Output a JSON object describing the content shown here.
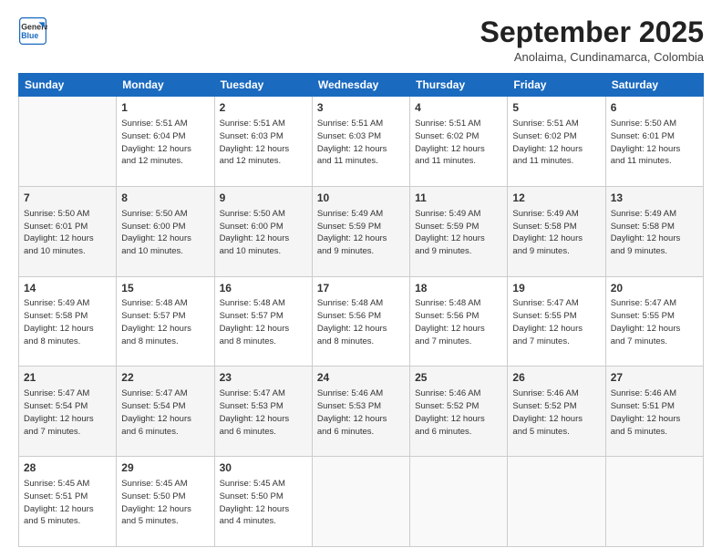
{
  "logo": {
    "line1": "General",
    "line2": "Blue"
  },
  "header": {
    "month": "September 2025",
    "location": "Anolaima, Cundinamarca, Colombia"
  },
  "weekdays": [
    "Sunday",
    "Monday",
    "Tuesday",
    "Wednesday",
    "Thursday",
    "Friday",
    "Saturday"
  ],
  "weeks": [
    [
      {
        "day": "",
        "info": ""
      },
      {
        "day": "1",
        "info": "Sunrise: 5:51 AM\nSunset: 6:04 PM\nDaylight: 12 hours\nand 12 minutes."
      },
      {
        "day": "2",
        "info": "Sunrise: 5:51 AM\nSunset: 6:03 PM\nDaylight: 12 hours\nand 12 minutes."
      },
      {
        "day": "3",
        "info": "Sunrise: 5:51 AM\nSunset: 6:03 PM\nDaylight: 12 hours\nand 11 minutes."
      },
      {
        "day": "4",
        "info": "Sunrise: 5:51 AM\nSunset: 6:02 PM\nDaylight: 12 hours\nand 11 minutes."
      },
      {
        "day": "5",
        "info": "Sunrise: 5:51 AM\nSunset: 6:02 PM\nDaylight: 12 hours\nand 11 minutes."
      },
      {
        "day": "6",
        "info": "Sunrise: 5:50 AM\nSunset: 6:01 PM\nDaylight: 12 hours\nand 11 minutes."
      }
    ],
    [
      {
        "day": "7",
        "info": "Sunrise: 5:50 AM\nSunset: 6:01 PM\nDaylight: 12 hours\nand 10 minutes."
      },
      {
        "day": "8",
        "info": "Sunrise: 5:50 AM\nSunset: 6:00 PM\nDaylight: 12 hours\nand 10 minutes."
      },
      {
        "day": "9",
        "info": "Sunrise: 5:50 AM\nSunset: 6:00 PM\nDaylight: 12 hours\nand 10 minutes."
      },
      {
        "day": "10",
        "info": "Sunrise: 5:49 AM\nSunset: 5:59 PM\nDaylight: 12 hours\nand 9 minutes."
      },
      {
        "day": "11",
        "info": "Sunrise: 5:49 AM\nSunset: 5:59 PM\nDaylight: 12 hours\nand 9 minutes."
      },
      {
        "day": "12",
        "info": "Sunrise: 5:49 AM\nSunset: 5:58 PM\nDaylight: 12 hours\nand 9 minutes."
      },
      {
        "day": "13",
        "info": "Sunrise: 5:49 AM\nSunset: 5:58 PM\nDaylight: 12 hours\nand 9 minutes."
      }
    ],
    [
      {
        "day": "14",
        "info": "Sunrise: 5:49 AM\nSunset: 5:58 PM\nDaylight: 12 hours\nand 8 minutes."
      },
      {
        "day": "15",
        "info": "Sunrise: 5:48 AM\nSunset: 5:57 PM\nDaylight: 12 hours\nand 8 minutes."
      },
      {
        "day": "16",
        "info": "Sunrise: 5:48 AM\nSunset: 5:57 PM\nDaylight: 12 hours\nand 8 minutes."
      },
      {
        "day": "17",
        "info": "Sunrise: 5:48 AM\nSunset: 5:56 PM\nDaylight: 12 hours\nand 8 minutes."
      },
      {
        "day": "18",
        "info": "Sunrise: 5:48 AM\nSunset: 5:56 PM\nDaylight: 12 hours\nand 7 minutes."
      },
      {
        "day": "19",
        "info": "Sunrise: 5:47 AM\nSunset: 5:55 PM\nDaylight: 12 hours\nand 7 minutes."
      },
      {
        "day": "20",
        "info": "Sunrise: 5:47 AM\nSunset: 5:55 PM\nDaylight: 12 hours\nand 7 minutes."
      }
    ],
    [
      {
        "day": "21",
        "info": "Sunrise: 5:47 AM\nSunset: 5:54 PM\nDaylight: 12 hours\nand 7 minutes."
      },
      {
        "day": "22",
        "info": "Sunrise: 5:47 AM\nSunset: 5:54 PM\nDaylight: 12 hours\nand 6 minutes."
      },
      {
        "day": "23",
        "info": "Sunrise: 5:47 AM\nSunset: 5:53 PM\nDaylight: 12 hours\nand 6 minutes."
      },
      {
        "day": "24",
        "info": "Sunrise: 5:46 AM\nSunset: 5:53 PM\nDaylight: 12 hours\nand 6 minutes."
      },
      {
        "day": "25",
        "info": "Sunrise: 5:46 AM\nSunset: 5:52 PM\nDaylight: 12 hours\nand 6 minutes."
      },
      {
        "day": "26",
        "info": "Sunrise: 5:46 AM\nSunset: 5:52 PM\nDaylight: 12 hours\nand 5 minutes."
      },
      {
        "day": "27",
        "info": "Sunrise: 5:46 AM\nSunset: 5:51 PM\nDaylight: 12 hours\nand 5 minutes."
      }
    ],
    [
      {
        "day": "28",
        "info": "Sunrise: 5:45 AM\nSunset: 5:51 PM\nDaylight: 12 hours\nand 5 minutes."
      },
      {
        "day": "29",
        "info": "Sunrise: 5:45 AM\nSunset: 5:50 PM\nDaylight: 12 hours\nand 5 minutes."
      },
      {
        "day": "30",
        "info": "Sunrise: 5:45 AM\nSunset: 5:50 PM\nDaylight: 12 hours\nand 4 minutes."
      },
      {
        "day": "",
        "info": ""
      },
      {
        "day": "",
        "info": ""
      },
      {
        "day": "",
        "info": ""
      },
      {
        "day": "",
        "info": ""
      }
    ]
  ]
}
